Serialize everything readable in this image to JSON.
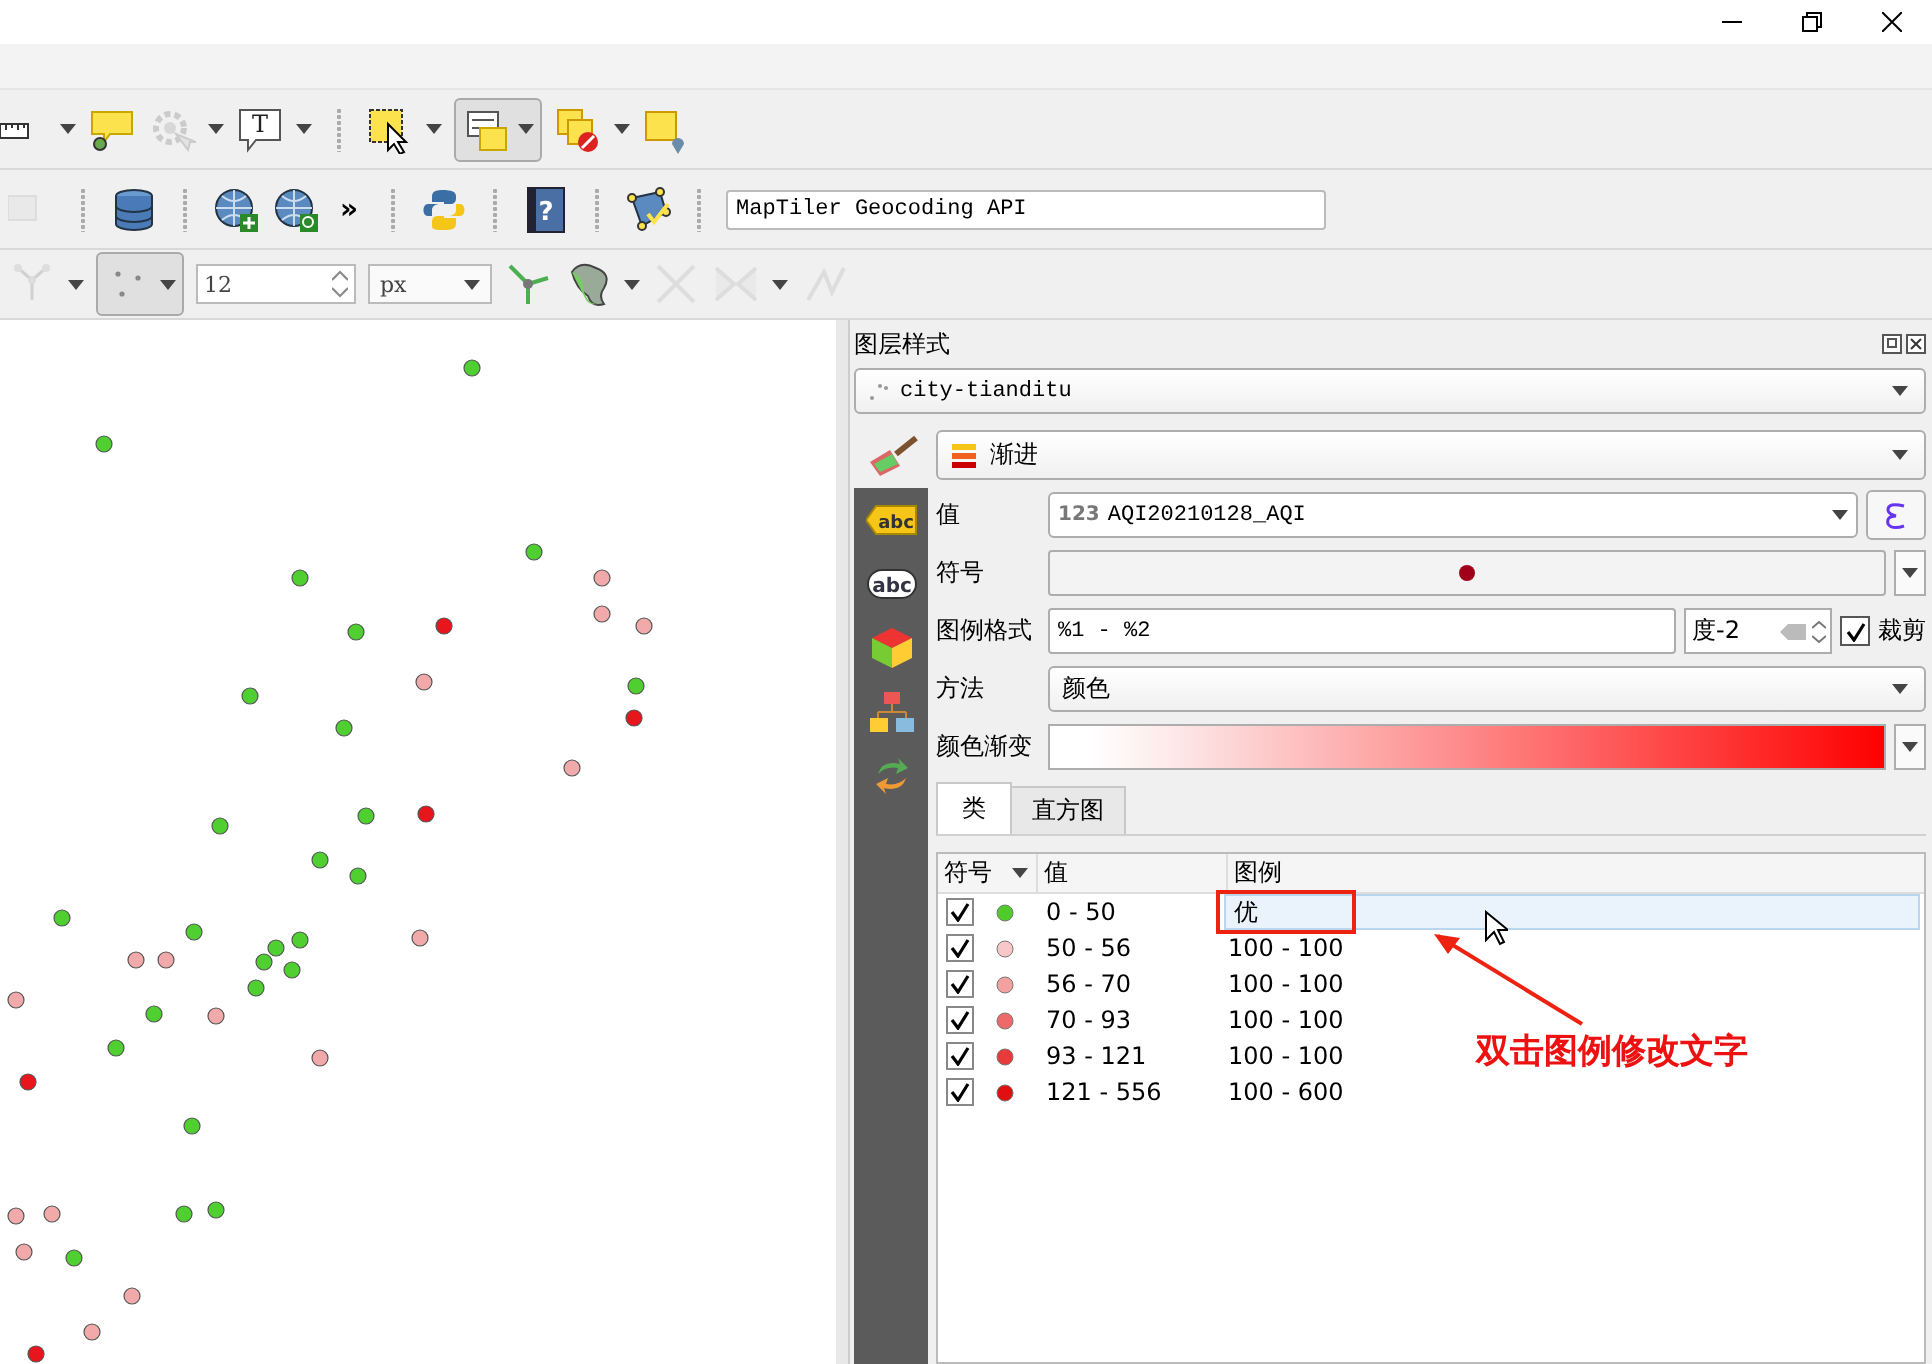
{
  "toolbars": [
    {
      "groups": [
        {
          "items": [
            {
              "kind": "measure",
              "disabled": false,
              "dropdown": true,
              "pressed": false
            },
            {
              "kind": "callout",
              "disabled": false,
              "dropdown": false,
              "pressed": false
            },
            {
              "kind": "action",
              "disabled": true,
              "dropdown": true,
              "pressed": false
            },
            {
              "kind": "text-annotation",
              "glyph": "T",
              "disabled": false,
              "dropdown": true,
              "pressed": false
            }
          ]
        },
        {
          "items": [
            {
              "kind": "select",
              "disabled": false,
              "dropdown": true,
              "pressed": false
            },
            {
              "kind": "attribute-form",
              "disabled": false,
              "dropdown": true,
              "pressed": true
            },
            {
              "kind": "deselect",
              "disabled": false,
              "dropdown": true,
              "pressed": false
            },
            {
              "kind": "pin",
              "disabled": false,
              "dropdown": false,
              "pressed": false
            }
          ]
        }
      ]
    },
    {
      "groups": [
        {
          "items": [
            {
              "kind": "label-edit",
              "disabled": true,
              "dropdown": false,
              "pressed": false
            }
          ]
        },
        {
          "items": [
            {
              "kind": "database",
              "disabled": false,
              "dropdown": false,
              "pressed": false
            }
          ]
        },
        {
          "items": [
            {
              "kind": "globe-plus",
              "disabled": false,
              "dropdown": false,
              "pressed": false
            },
            {
              "kind": "globe-search",
              "disabled": false,
              "dropdown": false,
              "pressed": false
            },
            {
              "kind": "overflow",
              "glyph": "»"
            }
          ]
        },
        {
          "items": [
            {
              "kind": "python",
              "disabled": false,
              "dropdown": false,
              "pressed": false
            }
          ]
        },
        {
          "items": [
            {
              "kind": "help",
              "glyph": "?",
              "disabled": false,
              "dropdown": false,
              "pressed": false
            }
          ]
        },
        {
          "items": [
            {
              "kind": "digitize",
              "disabled": false,
              "dropdown": false,
              "pressed": false
            }
          ]
        },
        {
          "items": [
            {
              "kind": "field",
              "value": "MapTiler Geocoding API"
            }
          ]
        }
      ]
    },
    {
      "groups": [
        {
          "items": [
            {
              "kind": "vertex",
              "disabled": true,
              "dropdown": true,
              "pressed": false
            },
            {
              "kind": "snap",
              "disabled": false,
              "dropdown": true,
              "pressed": true
            },
            {
              "kind": "spin",
              "value": "12"
            },
            {
              "kind": "combo",
              "value": "px"
            },
            {
              "kind": "split",
              "disabled": false,
              "dropdown": false,
              "pressed": false
            },
            {
              "kind": "reshape",
              "disabled": false,
              "dropdown": true,
              "pressed": false
            },
            {
              "kind": "delete",
              "disabled": true,
              "dropdown": false,
              "pressed": false
            },
            {
              "kind": "merge",
              "disabled": true,
              "dropdown": true,
              "pressed": false
            },
            {
              "kind": "rotate",
              "disabled": true,
              "dropdown": false,
              "pressed": false
            }
          ]
        }
      ]
    }
  ],
  "style_panel": {
    "title": "图层样式",
    "layer": "city-tianditu",
    "renderer": "渐进",
    "side_tabs": [
      {
        "kind": "symbology",
        "selected": true
      },
      {
        "kind": "labels",
        "glyph": "abc",
        "selected": false
      },
      {
        "kind": "masks",
        "glyph": "abc",
        "selected": false
      },
      {
        "kind": "cube",
        "selected": false
      },
      {
        "kind": "diagrams",
        "selected": false
      },
      {
        "kind": "history",
        "selected": false
      }
    ],
    "value": {
      "label": "值",
      "type_badge": "123",
      "field": "AQI20210128_AQI"
    },
    "symbol": {
      "label": "符号"
    },
    "legend_format": {
      "label": "图例格式",
      "value": "%1 - %2",
      "precision": "度-2",
      "trim_label": "裁剪",
      "trim_checked": true
    },
    "method": {
      "label": "方法",
      "value": "颜色"
    },
    "color_ramp": {
      "label": "颜色渐变"
    },
    "tabs": [
      {
        "label": "类",
        "selected": true
      },
      {
        "label": "直方图",
        "selected": false
      }
    ],
    "table": {
      "columns": [
        "符号",
        "值",
        "图例"
      ],
      "rows": [
        {
          "checked": true,
          "color": "#4fcc2a",
          "value": "0 - 50",
          "legend": "优",
          "selected": true
        },
        {
          "checked": true,
          "color": "#f8c8c8",
          "value": "50 - 56",
          "legend": "100 - 100",
          "selected": false
        },
        {
          "checked": true,
          "color": "#f3a0a0",
          "value": "56 - 70",
          "legend": "100 - 100",
          "selected": false
        },
        {
          "checked": true,
          "color": "#ec6a6a",
          "value": "70 - 93",
          "legend": "100 - 100",
          "selected": false
        },
        {
          "checked": true,
          "color": "#e83a3a",
          "value": "93 - 121",
          "legend": "100 - 100",
          "selected": false
        },
        {
          "checked": true,
          "color": "#e01010",
          "value": "121 - 556",
          "legend": "100 - 600",
          "selected": false
        }
      ]
    }
  },
  "annotation": {
    "text": "双击图例修改文字"
  }
}
